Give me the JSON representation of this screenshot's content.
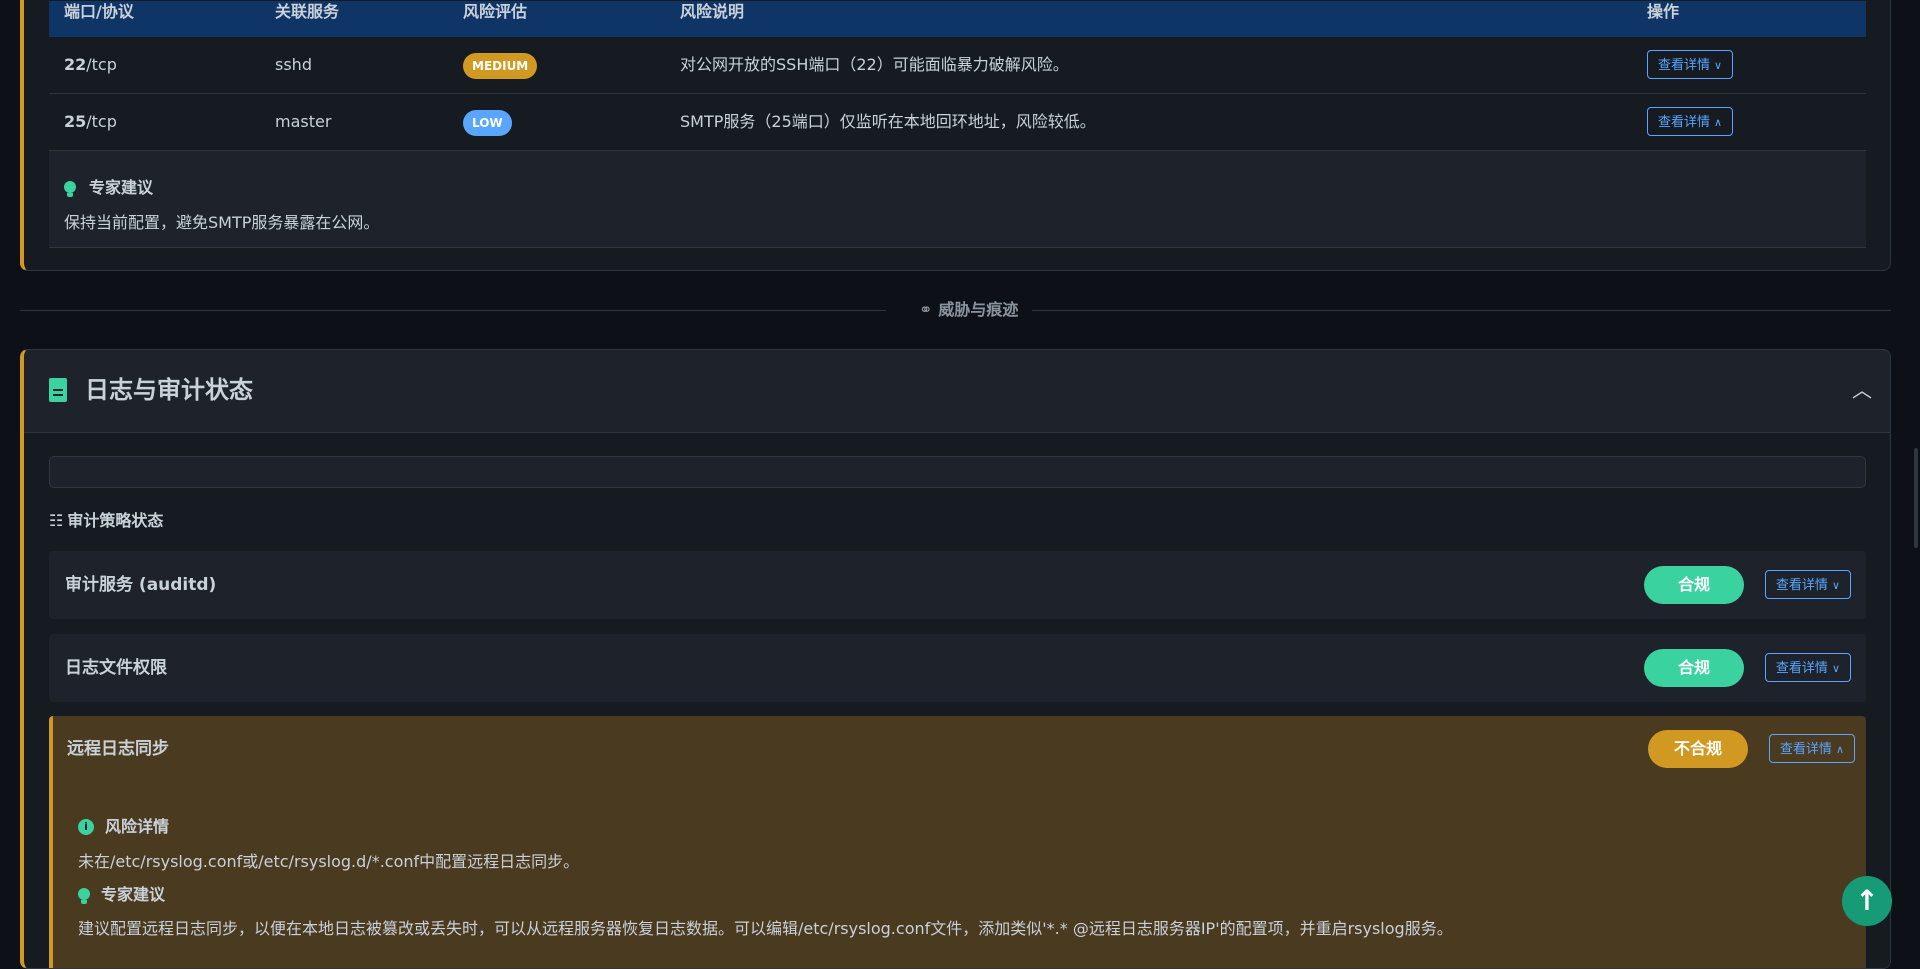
{
  "ports": {
    "columns": [
      "端口/协议",
      "关联服务",
      "风险评估",
      "风险说明",
      "操作"
    ],
    "rows": [
      {
        "port": "22",
        "proto": "/tcp",
        "service": "sshd",
        "risk": "MEDIUM",
        "risk_color": "#d29922",
        "desc": "对公网开放的SSH端口（22）可能面临暴力破解风险。",
        "action": "查看详情",
        "chevron": "∨"
      },
      {
        "port": "25",
        "proto": "/tcp",
        "service": "master",
        "risk": "LOW",
        "risk_color": "#58a6ff",
        "desc": "SMTP服务（25端口）仅监听在本地回环地址，风险较低。",
        "action": "查看详情",
        "chevron": "∧"
      }
    ],
    "advice_title": "专家建议",
    "advice_text": "保持当前配置，避免SMTP服务暴露在公网。"
  },
  "divider": {
    "label": "威胁与痕迹"
  },
  "log_section": {
    "title": "日志与审计状态",
    "policy_heading": "审计策略状态",
    "rows": [
      {
        "label": "审计服务 (auditd)",
        "status": "合规",
        "status_color": "#3ad29f",
        "action": "查看详情",
        "chevron": "∨"
      },
      {
        "label": "日志文件权限",
        "status": "合规",
        "status_color": "#3ad29f",
        "action": "查看详情",
        "chevron": "∨"
      }
    ],
    "remote": {
      "label": "远程日志同步",
      "status": "不合规",
      "status_color": "#d29922",
      "action": "查看详情",
      "chevron": "∧",
      "risk_title": "风险详情",
      "risk_text": "未在/etc/rsyslog.conf或/etc/rsyslog.d/*.conf中配置远程日志同步。",
      "advice_title": "专家建议",
      "advice_text": "建议配置远程日志同步，以便在本地日志被篡改或丢失时，可以从远程服务器恢复日志数据。可以编辑/etc/rsyslog.conf文件，添加类似'*.* @远程日志服务器IP'的配置项，并重启rsyslog服务。"
    }
  },
  "back_to_top": "↑"
}
